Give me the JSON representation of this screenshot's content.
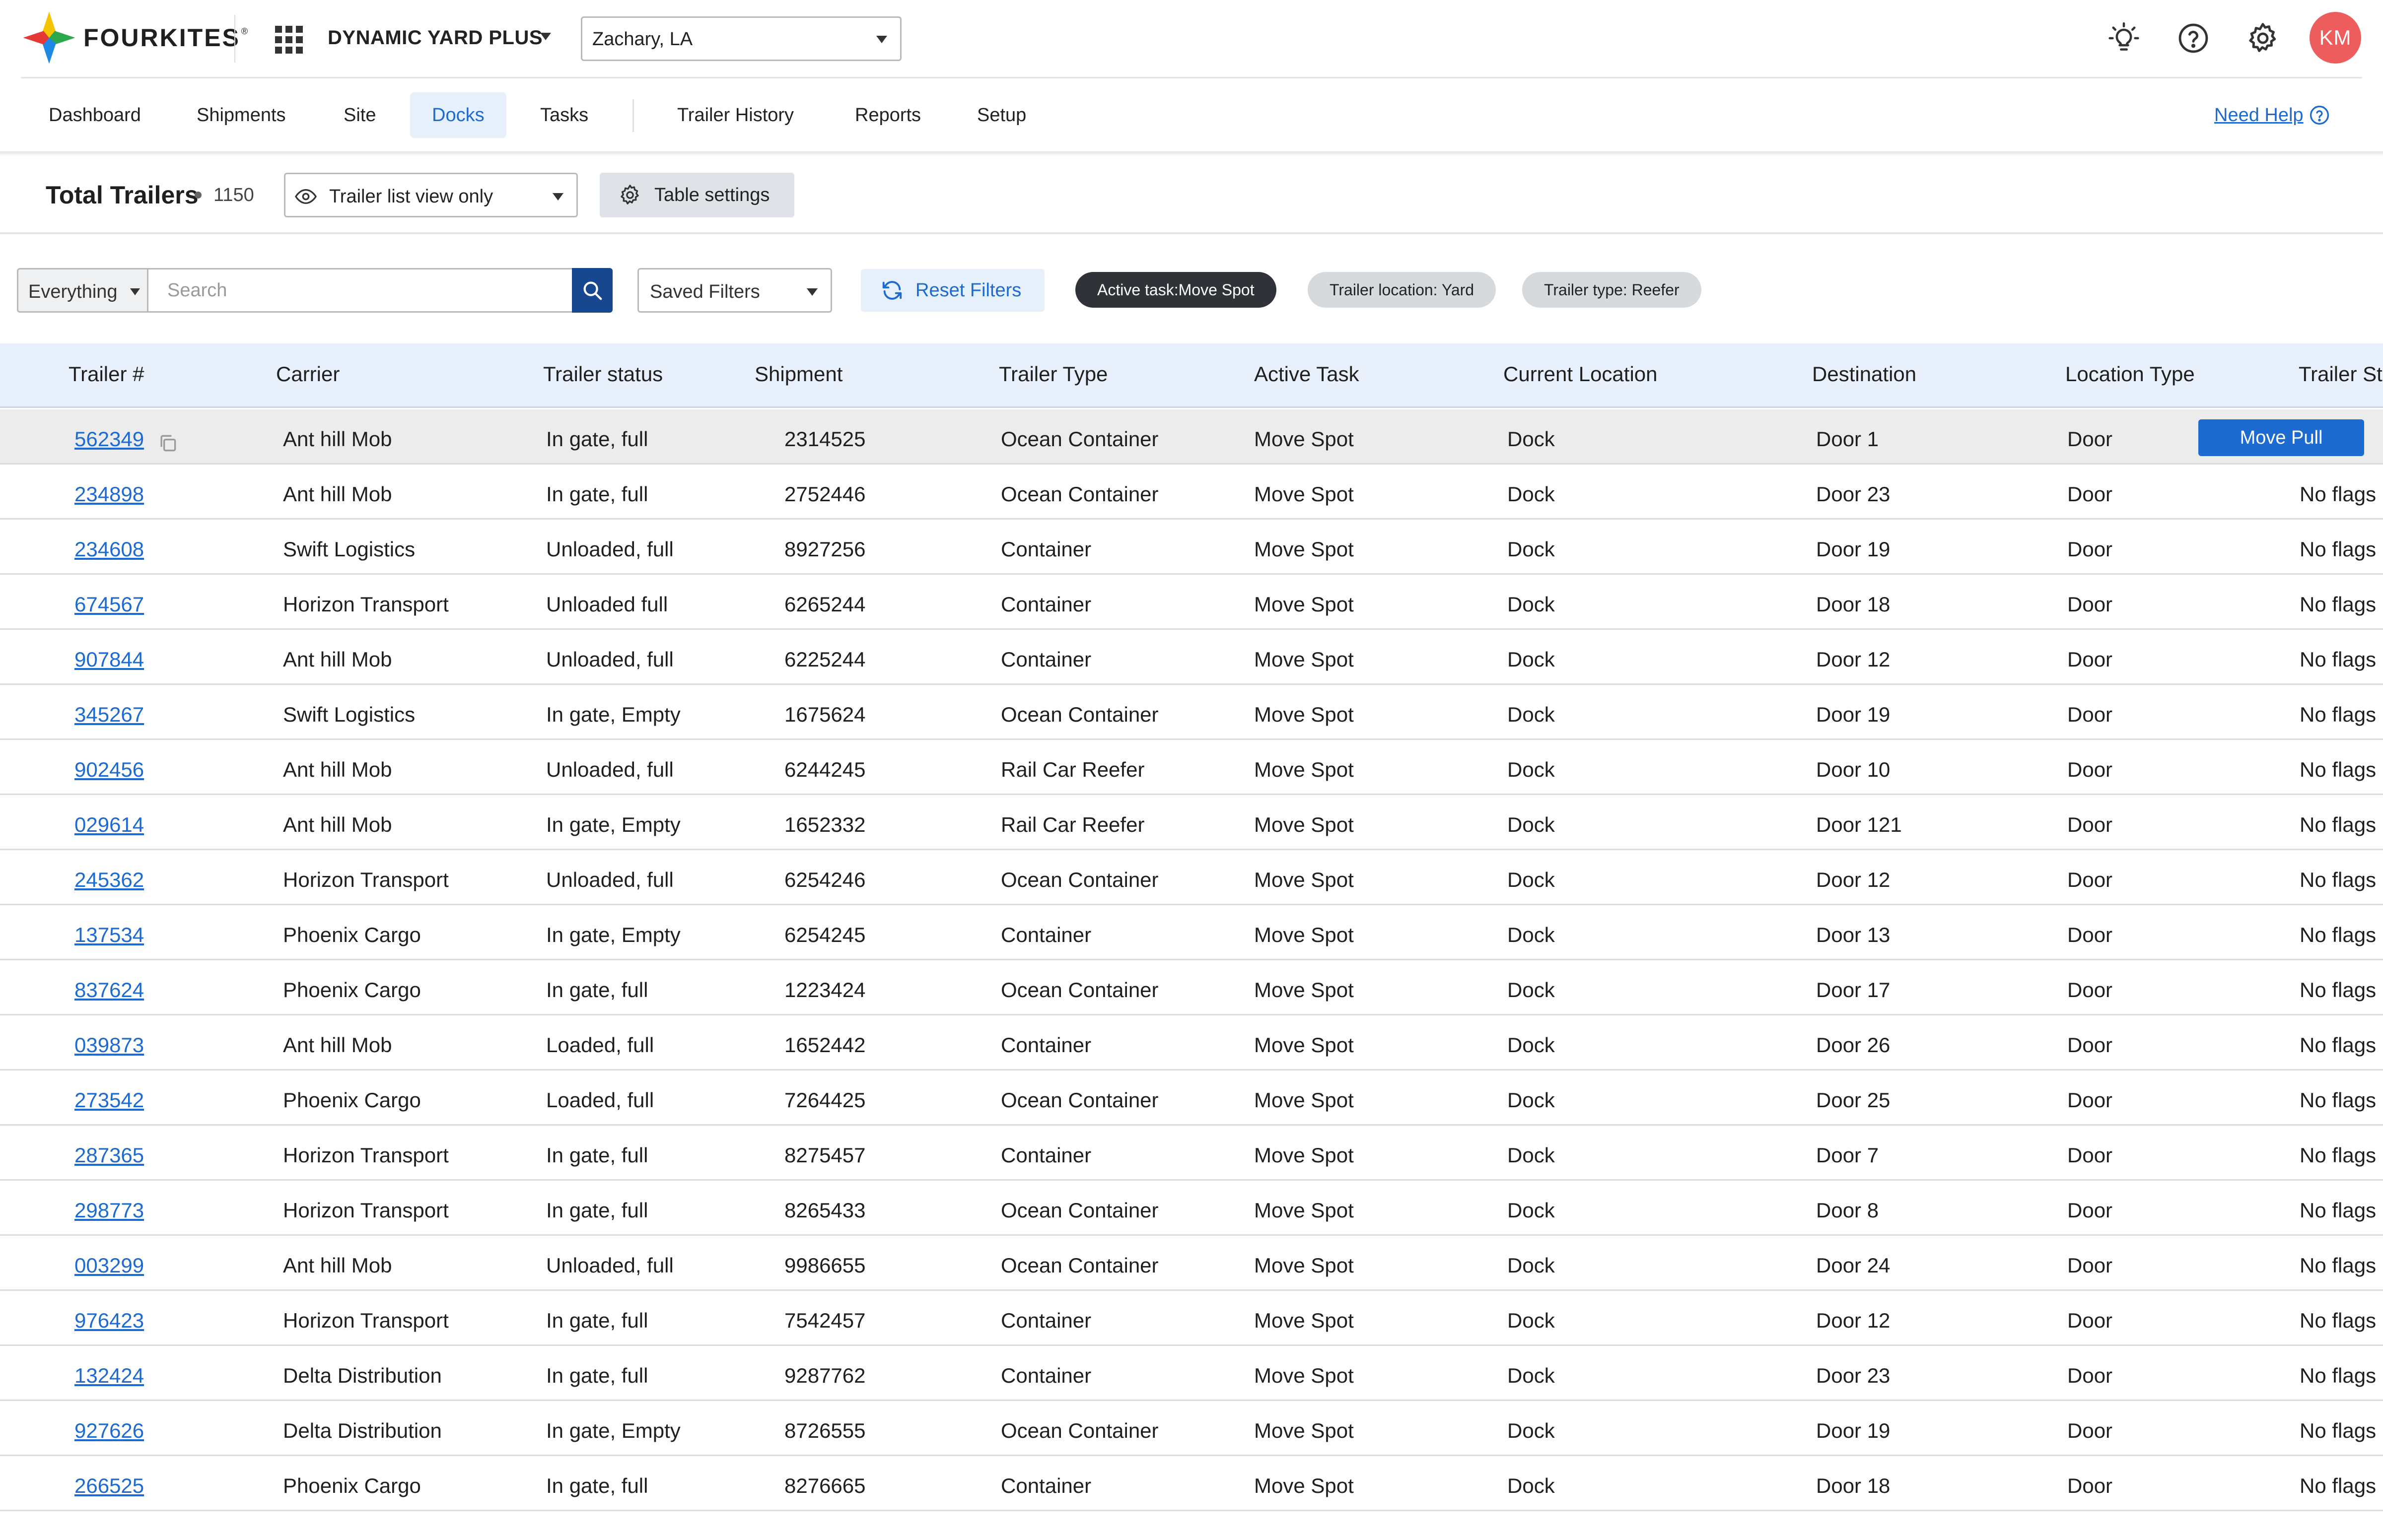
{
  "header": {
    "logo_text": "FOURKITES",
    "logo_reg": "®",
    "product_name": "DYNAMIC YARD PLUS",
    "site": "Zachary, LA",
    "avatar_initials": "KM"
  },
  "nav": {
    "items": [
      "Dashboard",
      "Shipments",
      "Site",
      "Docks",
      "Tasks",
      "Trailer History",
      "Reports",
      "Setup"
    ],
    "active": "Docks",
    "help_label": "Need Help"
  },
  "title_row": {
    "title": "Total Trailers",
    "count": "1150",
    "view_select": "Trailer list view only",
    "table_settings_label": "Table settings"
  },
  "filters": {
    "scope": "Everything",
    "search_placeholder": "Search",
    "saved_filters": "Saved Filters",
    "reset_label": "Reset Filters",
    "chips": [
      {
        "label": "Active task:Move Spot",
        "style": "dark"
      },
      {
        "label": "Trailer location: Yard",
        "style": "light"
      },
      {
        "label": "Trailer type: Reefer",
        "style": "light"
      }
    ]
  },
  "table": {
    "columns": [
      "Trailer #",
      "Carrier",
      "Trailer status",
      "Shipment",
      "Trailer Type",
      "Active Task",
      "Current Location",
      "Destination",
      "Location Type",
      "Trailer St"
    ],
    "hover_action_label": "Move Pull",
    "rows": [
      {
        "trailer": "562349",
        "carrier": "Ant hill Mob",
        "status": "In gate, full",
        "shipment": "2314525",
        "type": "Ocean Container",
        "task": "Move Spot",
        "location": "Dock",
        "destination": "Door 1",
        "location_type": "Door",
        "flags": ""
      },
      {
        "trailer": "234898",
        "carrier": "Ant hill Mob",
        "status": "In gate, full",
        "shipment": "2752446",
        "type": "Ocean Container",
        "task": "Move Spot",
        "location": "Dock",
        "destination": "Door 23",
        "location_type": "Door",
        "flags": "No flags"
      },
      {
        "trailer": "234608",
        "carrier": "Swift Logistics",
        "status": "Unloaded, full",
        "shipment": "8927256",
        "type": "Container",
        "task": "Move Spot",
        "location": "Dock",
        "destination": "Door 19",
        "location_type": "Door",
        "flags": "No flags"
      },
      {
        "trailer": "674567",
        "carrier": "Horizon Transport",
        "status": "Unloaded full",
        "shipment": "6265244",
        "type": "Container",
        "task": "Move Spot",
        "location": "Dock",
        "destination": "Door 18",
        "location_type": "Door",
        "flags": "No flags"
      },
      {
        "trailer": "907844",
        "carrier": "Ant hill Mob",
        "status": "Unloaded, full",
        "shipment": "6225244",
        "type": "Container",
        "task": "Move Spot",
        "location": "Dock",
        "destination": "Door 12",
        "location_type": "Door",
        "flags": "No flags"
      },
      {
        "trailer": "345267",
        "carrier": "Swift Logistics",
        "status": "In gate, Empty",
        "shipment": "1675624",
        "type": "Ocean Container",
        "task": "Move Spot",
        "location": "Dock",
        "destination": "Door 19",
        "location_type": "Door",
        "flags": "No flags"
      },
      {
        "trailer": "902456",
        "carrier": "Ant hill Mob",
        "status": "Unloaded, full",
        "shipment": "6244245",
        "type": "Rail Car Reefer",
        "task": "Move Spot",
        "location": "Dock",
        "destination": "Door 10",
        "location_type": "Door",
        "flags": "No flags"
      },
      {
        "trailer": "029614",
        "carrier": "Ant hill Mob",
        "status": "In gate, Empty",
        "shipment": "1652332",
        "type": "Rail Car Reefer",
        "task": "Move Spot",
        "location": "Dock",
        "destination": "Door 121",
        "location_type": "Door",
        "flags": "No flags"
      },
      {
        "trailer": "245362",
        "carrier": "Horizon Transport",
        "status": "Unloaded, full",
        "shipment": "6254246",
        "type": "Ocean Container",
        "task": "Move Spot",
        "location": "Dock",
        "destination": "Door 12",
        "location_type": "Door",
        "flags": "No flags"
      },
      {
        "trailer": "137534",
        "carrier": "Phoenix Cargo",
        "status": "In gate, Empty",
        "shipment": "6254245",
        "type": "Container",
        "task": "Move Spot",
        "location": "Dock",
        "destination": "Door 13",
        "location_type": "Door",
        "flags": "No flags"
      },
      {
        "trailer": "837624",
        "carrier": "Phoenix Cargo",
        "status": "In gate, full",
        "shipment": "1223424",
        "type": "Ocean Container",
        "task": "Move Spot",
        "location": "Dock",
        "destination": "Door 17",
        "location_type": "Door",
        "flags": "No flags"
      },
      {
        "trailer": "039873",
        "carrier": "Ant hill Mob",
        "status": "Loaded, full",
        "shipment": "1652442",
        "type": "Container",
        "task": "Move Spot",
        "location": "Dock",
        "destination": "Door 26",
        "location_type": "Door",
        "flags": "No flags"
      },
      {
        "trailer": "273542",
        "carrier": "Phoenix Cargo",
        "status": "Loaded, full",
        "shipment": "7264425",
        "type": "Ocean Container",
        "task": "Move Spot",
        "location": "Dock",
        "destination": "Door 25",
        "location_type": "Door",
        "flags": "No flags"
      },
      {
        "trailer": "287365",
        "carrier": "Horizon Transport",
        "status": "In gate, full",
        "shipment": "8275457",
        "type": "Container",
        "task": "Move Spot",
        "location": "Dock",
        "destination": "Door 7",
        "location_type": "Door",
        "flags": "No flags"
      },
      {
        "trailer": "298773",
        "carrier": "Horizon Transport",
        "status": "In gate, full",
        "shipment": "8265433",
        "type": "Ocean Container",
        "task": "Move Spot",
        "location": "Dock",
        "destination": "Door 8",
        "location_type": "Door",
        "flags": "No flags"
      },
      {
        "trailer": "003299",
        "carrier": "Ant hill Mob",
        "status": "Unloaded, full",
        "shipment": "9986655",
        "type": "Ocean Container",
        "task": "Move Spot",
        "location": "Dock",
        "destination": "Door 24",
        "location_type": "Door",
        "flags": "No flags"
      },
      {
        "trailer": "976423",
        "carrier": "Horizon Transport",
        "status": "In gate, full",
        "shipment": "7542457",
        "type": "Container",
        "task": "Move Spot",
        "location": "Dock",
        "destination": "Door 12",
        "location_type": "Door",
        "flags": "No flags"
      },
      {
        "trailer": "132424",
        "carrier": "Delta Distribution",
        "status": "In gate, full",
        "shipment": "9287762",
        "type": "Container",
        "task": "Move Spot",
        "location": "Dock",
        "destination": "Door 23",
        "location_type": "Door",
        "flags": "No flags"
      },
      {
        "trailer": "927626",
        "carrier": "Delta Distribution",
        "status": "In gate, Empty",
        "shipment": "8726555",
        "type": "Ocean Container",
        "task": "Move Spot",
        "location": "Dock",
        "destination": "Door 19",
        "location_type": "Door",
        "flags": "No flags"
      },
      {
        "trailer": "266525",
        "carrier": "Phoenix Cargo",
        "status": "In gate, full",
        "shipment": "8276665",
        "type": "Container",
        "task": "Move Spot",
        "location": "Dock",
        "destination": "Door 18",
        "location_type": "Door",
        "flags": "No flags"
      }
    ]
  },
  "colors": {
    "accent": "#1d6ad1",
    "header_row": "#e8f1fb",
    "avatar": "#ee5d5d",
    "search_button": "#17478f"
  },
  "icons": {
    "logo": "fourkites-diamond-logo",
    "apps": "apps-grid-icon",
    "ideas": "lightbulb-icon",
    "help": "help-circle-icon",
    "settings": "gear-icon",
    "view": "eye-icon",
    "search": "search-icon",
    "reset": "refresh-icon",
    "copy": "copy-icon"
  }
}
